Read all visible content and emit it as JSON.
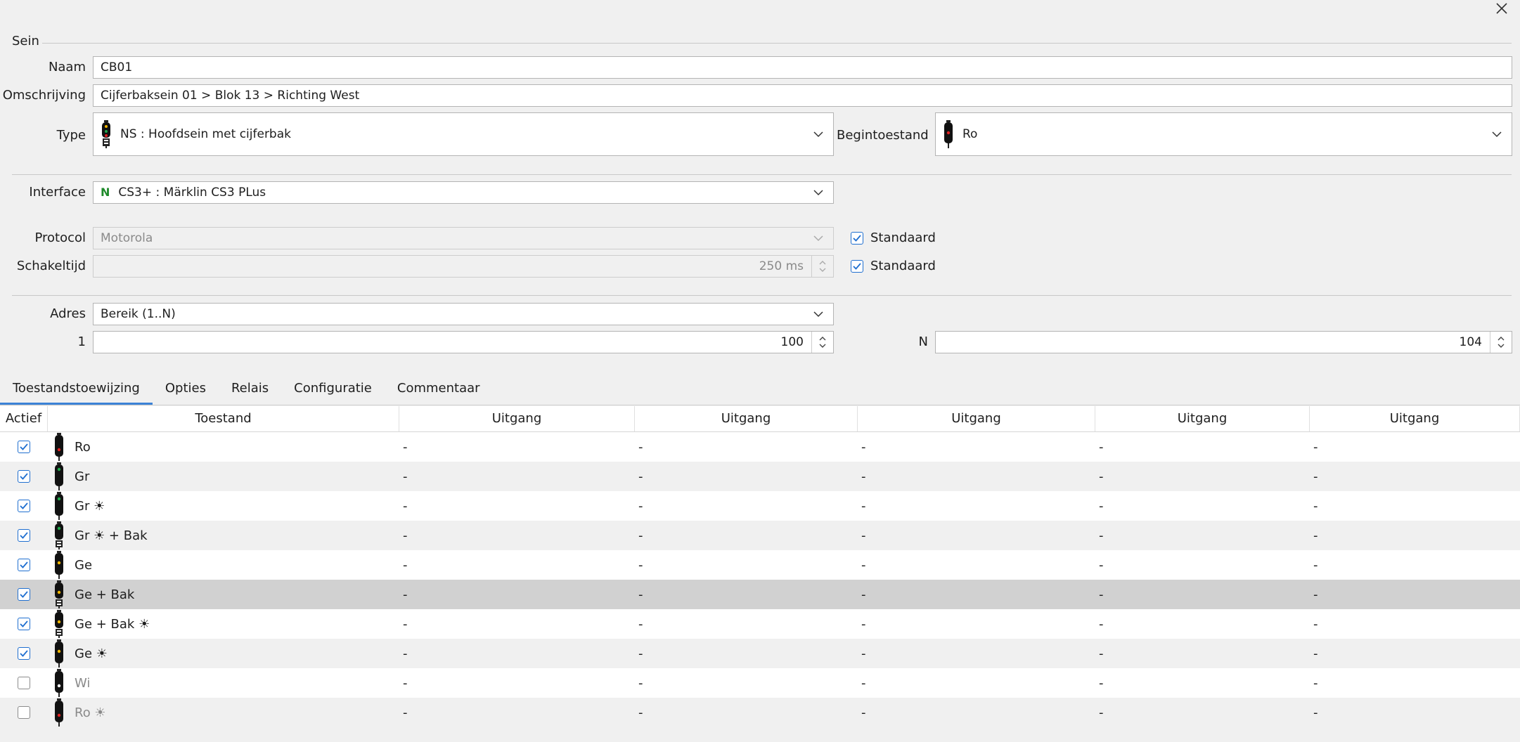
{
  "group_title": "Sein",
  "labels": {
    "naam": "Naam",
    "omschrijving": "Omschrijving",
    "type": "Type",
    "begintoestand": "Begintoestand",
    "interface": "Interface",
    "protocol": "Protocol",
    "schakeltijd": "Schakeltijd",
    "adres": "Adres",
    "first": "1",
    "last": "N"
  },
  "values": {
    "naam": "CB01",
    "omschrijving": "Cijferbaksein 01 > Blok 13 > Richting West",
    "type": "NS : Hoofdsein met cijferbak",
    "begintoestand": "Ro",
    "interface_letter": "N",
    "interface": "CS3+ : Märklin CS3 PLus",
    "protocol": "Motorola",
    "schakeltijd": "250 ms",
    "adres": "Bereik (1..N)",
    "first": "100",
    "last": "104",
    "standaard_label": "Standaard"
  },
  "tabs": [
    {
      "label": "Toestandstoewijzing",
      "active": true
    },
    {
      "label": "Opties"
    },
    {
      "label": "Relais"
    },
    {
      "label": "Configuratie"
    },
    {
      "label": "Commentaar"
    }
  ],
  "table": {
    "headers": [
      "Actief",
      "Toestand",
      "Uitgang",
      "Uitgang",
      "Uitgang",
      "Uitgang",
      "Uitgang"
    ],
    "rows": [
      {
        "active": true,
        "state": "Ro",
        "light": "red",
        "bak": false,
        "outputs": [
          "-",
          "-",
          "-",
          "-",
          "-"
        ]
      },
      {
        "active": true,
        "state": "Gr",
        "light": "green",
        "bak": false,
        "outputs": [
          "-",
          "-",
          "-",
          "-",
          "-"
        ]
      },
      {
        "active": true,
        "state": "Gr ☀",
        "light": "green",
        "bak": false,
        "outputs": [
          "-",
          "-",
          "-",
          "-",
          "-"
        ]
      },
      {
        "active": true,
        "state": "Gr ☀ + Bak",
        "light": "green",
        "bak": true,
        "outputs": [
          "-",
          "-",
          "-",
          "-",
          "-"
        ]
      },
      {
        "active": true,
        "state": "Ge",
        "light": "yellow",
        "bak": false,
        "outputs": [
          "-",
          "-",
          "-",
          "-",
          "-"
        ]
      },
      {
        "active": true,
        "state": "Ge + Bak",
        "light": "yellow",
        "bak": true,
        "outputs": [
          "-",
          "-",
          "-",
          "-",
          "-"
        ],
        "selected": true
      },
      {
        "active": true,
        "state": "Ge + Bak ☀",
        "light": "yellow",
        "bak": true,
        "outputs": [
          "-",
          "-",
          "-",
          "-",
          "-"
        ]
      },
      {
        "active": true,
        "state": "Ge ☀",
        "light": "yellow",
        "bak": false,
        "outputs": [
          "-",
          "-",
          "-",
          "-",
          "-"
        ]
      },
      {
        "active": false,
        "state": "Wi",
        "light": "white",
        "bak": false,
        "outputs": [
          "-",
          "-",
          "-",
          "-",
          "-"
        ]
      },
      {
        "active": false,
        "state": "Ro ☀",
        "light": "red",
        "bak": false,
        "outputs": [
          "-",
          "-",
          "-",
          "-",
          "-"
        ]
      }
    ]
  },
  "colors": {
    "accent": "#3b82d6",
    "checkbox": "#1f6fd0",
    "interface_letter": "#1f8a2b",
    "red": "#e02020",
    "green": "#1fa84a",
    "yellow": "#f5b800",
    "white": "#ffffff"
  },
  "icons": {
    "close": "close-icon",
    "dropdown": "chevron-down-icon",
    "spinner": "spinner-icon",
    "signal": "signal-icon",
    "check": "check-icon"
  }
}
